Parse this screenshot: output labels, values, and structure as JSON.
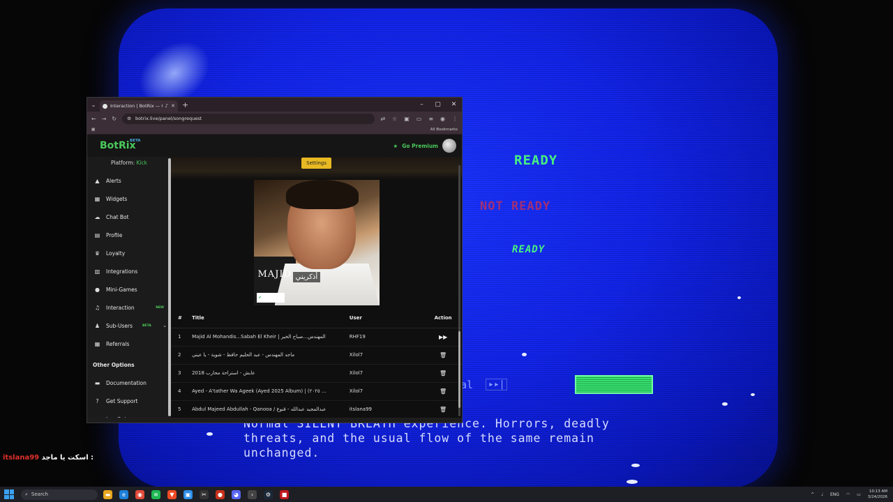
{
  "colors": {
    "accent": "#4ac95b",
    "premium": "#4ac95b",
    "settings_button": "#e8b923",
    "game_screen": "#1224e8"
  },
  "game": {
    "ready_1": "READY",
    "ready_2": "NOT READY",
    "ready_3": "READY",
    "body_text": "Normal SILENT BREATH experience. Horrors, deadly threats, and the usual flow of the same remain unchanged.",
    "glyph_left": "al",
    "glyph_skip": "▸▸|"
  },
  "chat": {
    "username": "itslana99",
    "message": "اسكت يا ماجد :"
  },
  "browser": {
    "tab_title": "Interaction | BotRix — Clo",
    "url": "botrix.live/panel/songrequest",
    "bookmarks_label": "All Bookmarks"
  },
  "app": {
    "logo": "BotRix",
    "logo_badge": "BETA",
    "premium_label": "Go Premium",
    "platform_label": "Platform:",
    "platform_value": "Kick",
    "settings_label": "Settings",
    "cover": {
      "artist": "MAJID",
      "album": "أذكريني"
    },
    "nav": [
      {
        "label": "Alerts",
        "icon": "alert-triangle-icon",
        "glyph": "▲"
      },
      {
        "label": "Widgets",
        "icon": "grid-icon",
        "glyph": "▦"
      },
      {
        "label": "Chat Bot",
        "icon": "robot-icon",
        "glyph": "☁"
      },
      {
        "label": "Profile",
        "icon": "id-card-icon",
        "glyph": "▤"
      },
      {
        "label": "Loyalty",
        "icon": "trophy-icon",
        "glyph": "♛"
      },
      {
        "label": "Integrations",
        "icon": "server-icon",
        "glyph": "▥"
      },
      {
        "label": "Mini-Games",
        "icon": "gamepad-icon",
        "glyph": "●"
      },
      {
        "label": "Interaction",
        "icon": "music-icon",
        "glyph": "♫",
        "badge": "NEW"
      },
      {
        "label": "Sub-Users",
        "icon": "users-icon",
        "glyph": "♟",
        "badge": "BETA"
      },
      {
        "label": "Referrals",
        "icon": "referral-icon",
        "glyph": "▦"
      }
    ],
    "other_options_title": "Other Options",
    "other_nav": [
      {
        "label": "Documentation",
        "icon": "book-icon",
        "glyph": "▬"
      },
      {
        "label": "Get Support",
        "icon": "question-icon",
        "glyph": "?"
      },
      {
        "label": "Log Out",
        "icon": "logout-icon",
        "glyph": "⇥"
      }
    ],
    "table": {
      "headers": {
        "num": "#",
        "title": "Title",
        "user": "User",
        "action": "Action"
      },
      "rows": [
        {
          "num": "1",
          "title": "Majid Al Mohandis...Sabah El Kheir | المهندس...صباح الخير",
          "user": "RHF19",
          "action": "skip-icon"
        },
        {
          "num": "2",
          "title": "ماجد المهندس - عبد الحليم حافظ - شوية - يا عيني",
          "user": "Xilol7",
          "action": "trash-icon"
        },
        {
          "num": "3",
          "title": "2018 عابش - استراحة محارب",
          "user": "Xilol7",
          "action": "trash-icon"
        },
        {
          "num": "4",
          "title": "Ayed - A'tather Wa Ageek (Ayed 2025 Album) | (٢٠٢٥ ...",
          "user": "Xilol7",
          "action": "trash-icon"
        },
        {
          "num": "5",
          "title": "Abdul Majeed Abdullah - Qanooa / عبدالمجيد عبدالله - قنوع",
          "user": "itslana99",
          "action": "trash-icon"
        }
      ]
    }
  },
  "taskbar": {
    "search_placeholder": "Search",
    "lang": "ENG",
    "time": "10:13 AM",
    "date": "3/24/2026"
  }
}
